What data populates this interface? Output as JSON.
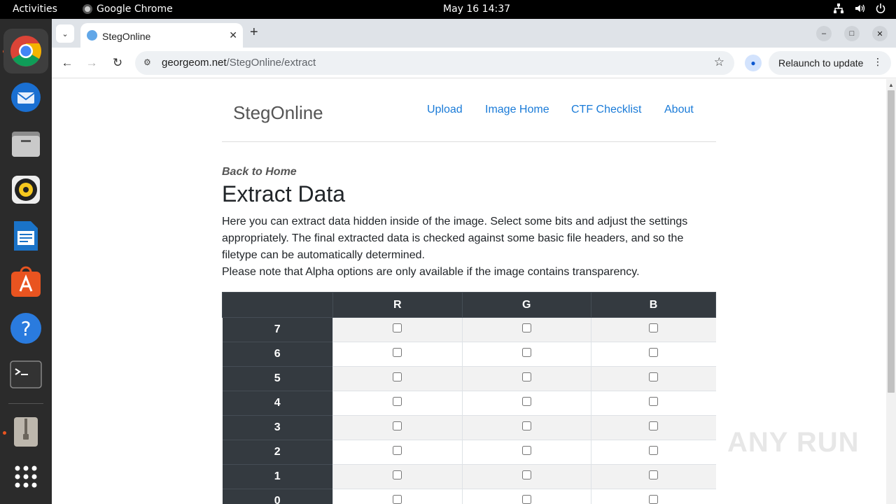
{
  "system": {
    "activities": "Activities",
    "app_name": "Google Chrome",
    "clock": "May 16  14:37"
  },
  "dock": {
    "apps": [
      "chrome",
      "thunderbird",
      "files",
      "rhythmbox",
      "writer",
      "app-center",
      "help",
      "terminal",
      "archive",
      "app-grid"
    ]
  },
  "browser": {
    "tab_title": "StegOnline",
    "url_host": "georgeom.net",
    "url_path": "/StegOnline/extract",
    "relaunch_label": "Relaunch to update"
  },
  "page": {
    "brand": "StegOnline",
    "nav": [
      "Upload",
      "Image Home",
      "CTF Checklist",
      "About"
    ],
    "back_link": "Back to Home",
    "heading": "Extract Data",
    "intro": [
      "Here you can extract data hidden inside of the image. Select some bits and adjust the settings appropriately. The final extracted data is checked against some basic file headers, and so the filetype can be automatically determined.",
      "Please note that Alpha options are only available if the image contains transparency."
    ],
    "table": {
      "columns": [
        "R",
        "G",
        "B"
      ],
      "rows": [
        "7",
        "6",
        "5",
        "4",
        "3",
        "2",
        "1",
        "0"
      ]
    },
    "watermark": "ANY RUN"
  }
}
